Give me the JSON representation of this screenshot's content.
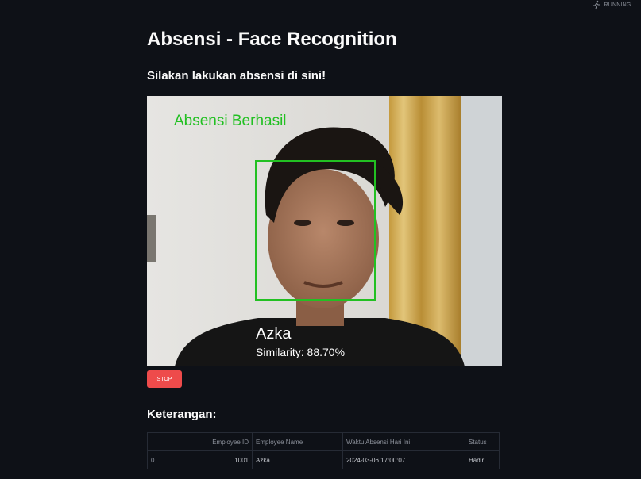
{
  "status_bar": {
    "label": "RUNNING...",
    "icon": "running-icon"
  },
  "page": {
    "title": "Absensi - Face Recognition",
    "subtitle": "Silakan lakukan absensi di sini!"
  },
  "camera": {
    "overlay_status": "Absensi Berhasil",
    "face_name": "Azka",
    "similarity_text": "Similarity: 88.70%",
    "similarity": 88.7,
    "box_color": "#22c022"
  },
  "controls": {
    "stop_label": "STOP",
    "stop_color": "#ee4b4b"
  },
  "keterangan": {
    "title": "Keterangan:",
    "columns": [
      "",
      "Employee ID",
      "Employee Name",
      "Waktu Absensi Hari Ini",
      "Status"
    ],
    "rows": [
      {
        "index": "0",
        "employee_id": "1001",
        "employee_name": "Azka",
        "time": "2024-03-06 17:00:07",
        "status": "Hadir"
      }
    ]
  }
}
